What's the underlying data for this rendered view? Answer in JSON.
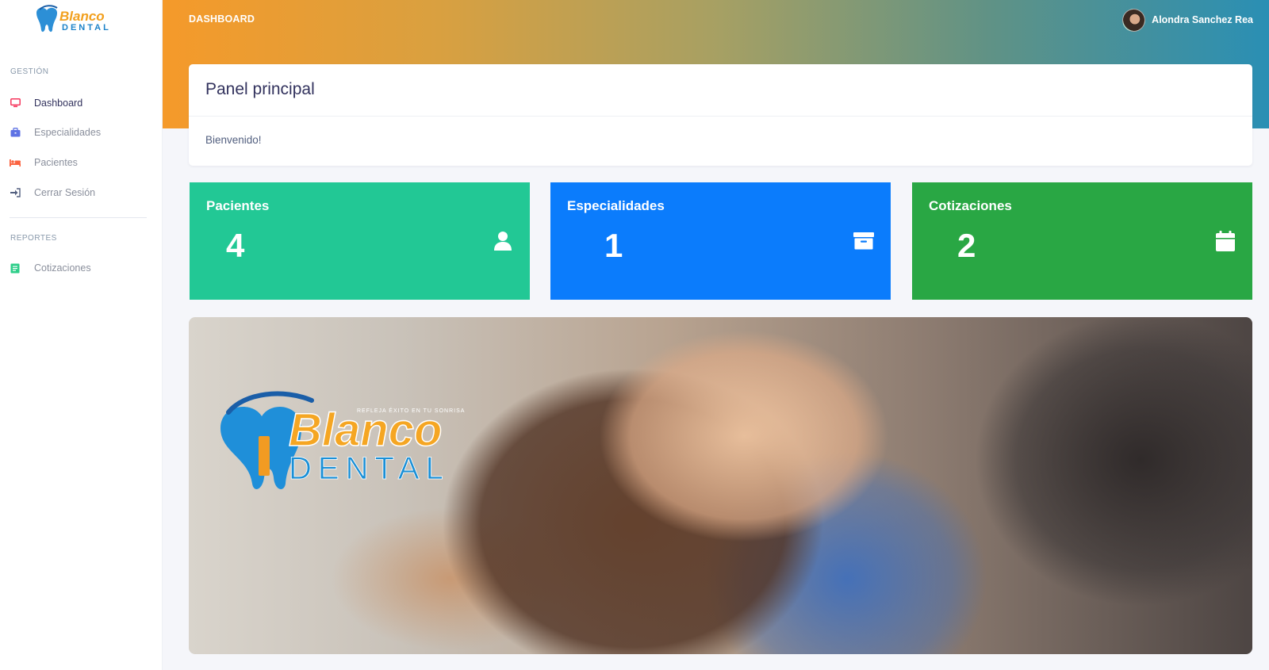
{
  "app": {
    "brand_line1": "Blanco",
    "brand_line2": "DENTAL",
    "brand_tagline": "REFLEJA ÉXITO EN TU SONRISA"
  },
  "sidebar": {
    "section_gestion": "GESTIÓN",
    "items": [
      {
        "label": "Dashboard",
        "icon": "monitor-icon",
        "color": "#f5365c"
      },
      {
        "label": "Especialidades",
        "icon": "briefcase-icon",
        "color": "#5e72e4"
      },
      {
        "label": "Pacientes",
        "icon": "bed-icon",
        "color": "#fb6340"
      },
      {
        "label": "Cerrar Sesión",
        "icon": "sign-in-icon",
        "color": "#525f7f"
      }
    ],
    "section_reportes": "REPORTES",
    "report_items": [
      {
        "label": "Cotizaciones",
        "icon": "report-icon",
        "color": "#2dce89"
      }
    ]
  },
  "header": {
    "title": "DASHBOARD",
    "user_name": "Alondra Sanchez Rea"
  },
  "panel": {
    "title": "Panel principal",
    "welcome": "Bienvenido!"
  },
  "stats": [
    {
      "title": "Pacientes",
      "value": "4",
      "icon": "user-icon",
      "color": "#22c895"
    },
    {
      "title": "Especialidades",
      "value": "1",
      "icon": "archive-icon",
      "color": "#0b7cfc"
    },
    {
      "title": "Cotizaciones",
      "value": "2",
      "icon": "calendar-icon",
      "color": "#29a744"
    }
  ]
}
